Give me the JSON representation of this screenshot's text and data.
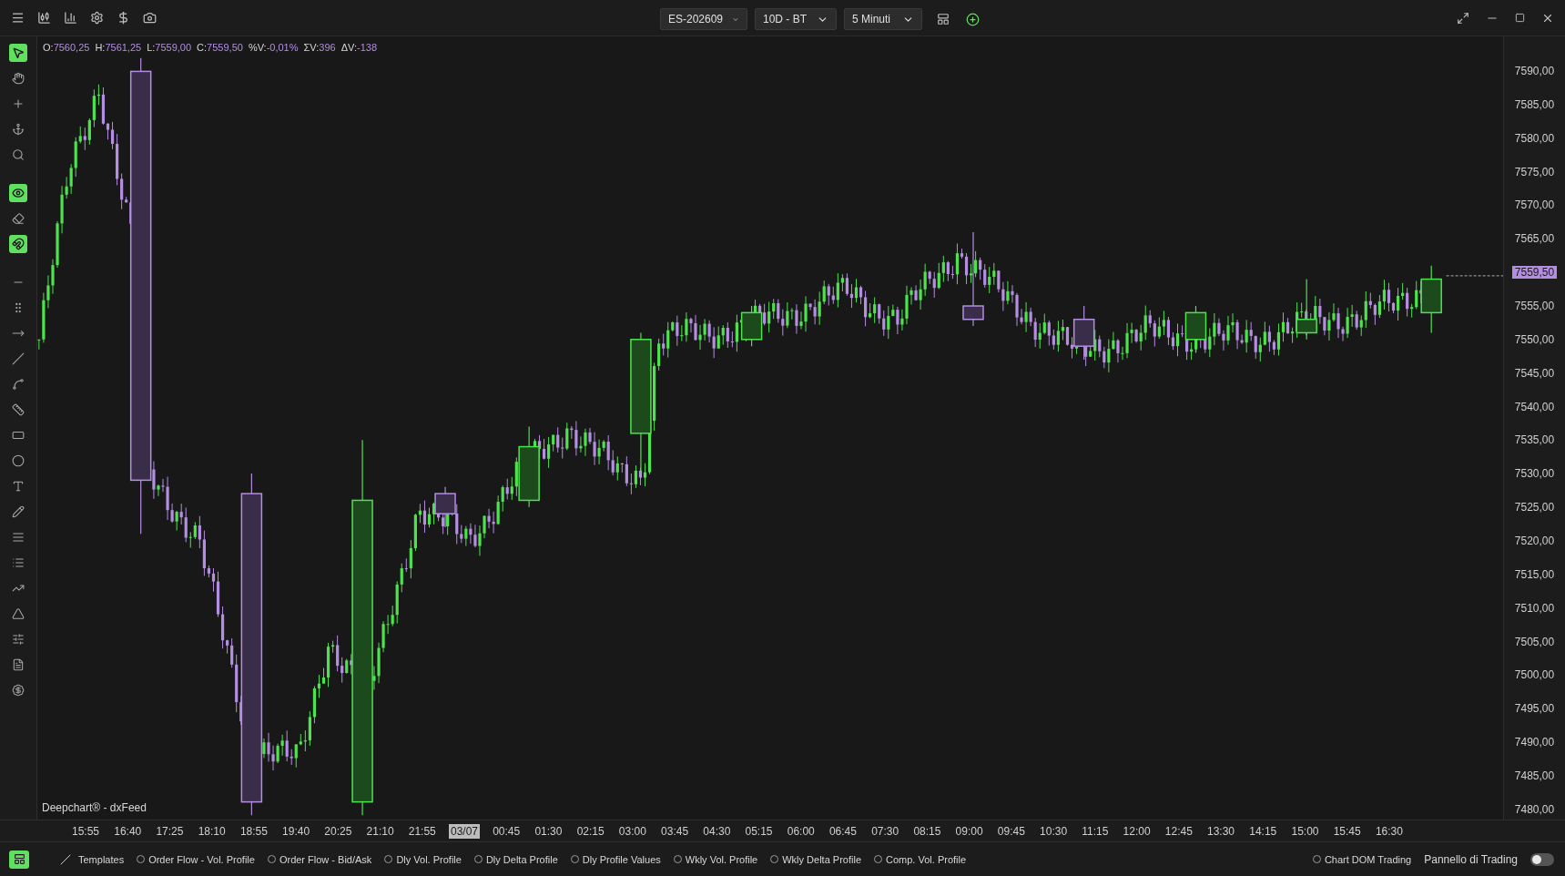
{
  "toolbar": {
    "symbol": "ES-202609",
    "range": "10D - BT",
    "timeframe": "5 Minuti"
  },
  "tools": [
    {
      "active": true
    },
    {
      "active": false
    },
    {
      "active": false
    },
    {
      "active": false
    },
    {
      "active": false
    },
    {
      "active": true
    },
    {
      "active": false
    },
    {
      "active": true
    },
    {
      "active": false
    },
    {
      "active": false
    },
    {
      "active": false
    },
    {
      "active": false
    },
    {
      "active": false
    },
    {
      "active": false
    },
    {
      "active": false
    },
    {
      "active": false
    },
    {
      "active": false
    },
    {
      "active": false
    },
    {
      "active": false
    },
    {
      "active": false
    },
    {
      "active": false
    },
    {
      "active": false
    },
    {
      "active": false
    },
    {
      "active": false
    },
    {
      "active": false
    }
  ],
  "ohlc": [
    {
      "label": "O:",
      "value": "7560,25"
    },
    {
      "label": "H:",
      "value": "7561,25"
    },
    {
      "label": "L:",
      "value": "7559,00"
    },
    {
      "label": "C:",
      "value": "7559,50"
    },
    {
      "label": "%V:",
      "value": "-0,01%"
    },
    {
      "label": "ΣV:",
      "value": "396"
    },
    {
      "label": "ΔV:",
      "value": "-138"
    }
  ],
  "chart": {
    "source": "Deepchart® - dxFeed",
    "current_price": "7559,50",
    "price_labels": [
      "7590,00",
      "7585,00",
      "7580,00",
      "7575,00",
      "7570,00",
      "7565,00",
      "7555,00",
      "7550,00",
      "7545,00",
      "7540,00",
      "7535,00",
      "7530,00",
      "7525,00",
      "7520,00",
      "7515,00",
      "7510,00",
      "7505,00",
      "7500,00",
      "7495,00",
      "7490,00",
      "7485,00",
      "7480,00"
    ],
    "time_labels": [
      {
        "label": "15:55",
        "selected": false
      },
      {
        "label": "16:40",
        "selected": false
      },
      {
        "label": "17:25",
        "selected": false
      },
      {
        "label": "18:10",
        "selected": false
      },
      {
        "label": "18:55",
        "selected": false
      },
      {
        "label": "19:40",
        "selected": false
      },
      {
        "label": "20:25",
        "selected": false
      },
      {
        "label": "21:10",
        "selected": false
      },
      {
        "label": "21:55",
        "selected": false
      },
      {
        "label": "03/07",
        "selected": true
      },
      {
        "label": "00:45",
        "selected": false
      },
      {
        "label": "01:30",
        "selected": false
      },
      {
        "label": "02:15",
        "selected": false
      },
      {
        "label": "03:00",
        "selected": false
      },
      {
        "label": "03:45",
        "selected": false
      },
      {
        "label": "04:30",
        "selected": false
      },
      {
        "label": "05:15",
        "selected": false
      },
      {
        "label": "06:00",
        "selected": false
      },
      {
        "label": "06:45",
        "selected": false
      },
      {
        "label": "07:30",
        "selected": false
      },
      {
        "label": "08:15",
        "selected": false
      },
      {
        "label": "09:00",
        "selected": false
      },
      {
        "label": "09:45",
        "selected": false
      },
      {
        "label": "10:30",
        "selected": false
      },
      {
        "label": "11:15",
        "selected": false
      },
      {
        "label": "12:00",
        "selected": false
      },
      {
        "label": "12:45",
        "selected": false
      },
      {
        "label": "13:30",
        "selected": false
      },
      {
        "label": "14:15",
        "selected": false
      },
      {
        "label": "15:00",
        "selected": false
      },
      {
        "label": "15:45",
        "selected": false
      },
      {
        "label": "16:30",
        "selected": false
      }
    ]
  },
  "bottom_bar": {
    "templates": "Templates",
    "options": [
      {
        "label": "Order Flow - Vol. Profile",
        "selected": false
      },
      {
        "label": "Order Flow - Bid/Ask",
        "selected": false
      },
      {
        "label": "Dly Vol. Profile",
        "selected": false
      },
      {
        "label": "Dly Delta Profile",
        "selected": false
      },
      {
        "label": "Dly Profile Values",
        "selected": false
      },
      {
        "label": "Wkly Vol. Profile",
        "selected": false
      },
      {
        "label": "Wkly Delta Profile",
        "selected": false
      },
      {
        "label": "Comp. Vol. Profile",
        "selected": false
      }
    ],
    "chart_dom": {
      "label": "Chart DOM Trading",
      "selected": false
    },
    "trading_panel": {
      "label": "Pannello di Trading",
      "on": false
    }
  }
}
